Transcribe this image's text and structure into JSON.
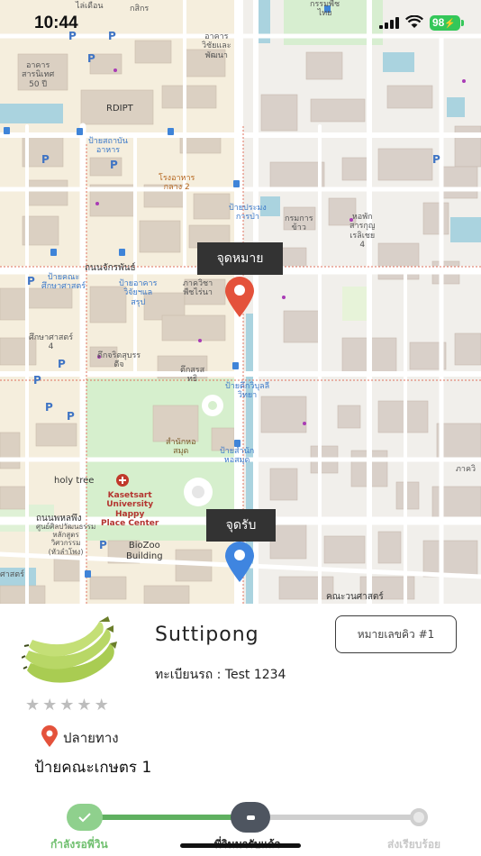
{
  "status_bar": {
    "time": "10:44",
    "battery": "98"
  },
  "map": {
    "labels": {
      "building_top": "ไล่เดือน",
      "building_top2": "กสิกร",
      "building_arts": "อาคาร\nวิชัยและ\nพัฒนา",
      "building_50y": "อาคาร\nสารนิเทศ\n50 ปี",
      "rdipt": "RDIPT",
      "canteen": "ป้ายสถาบัน\nอาหาร",
      "central2": "โรงอาหาร\nกลาง 2",
      "bus_stop_fisheries": "ป้ายประมง\nการป่า",
      "agri_dept": "กรมการ\nข้าว",
      "library_hall": "หอพัก\nสารกุญ\nเรลิเชย\n4",
      "chakphan_rd": "ถนนจักรพันธ์",
      "bus_stop_soc": "ป้ายคณะ\nศึกษาศาสตร์",
      "bus_stop_sci": "ป้ายอาคาร\nวิจัยฯแล\nสรุป",
      "museum": "ภาควิชา\nพืชไร่นา",
      "edu4": "ศึกษาศาสตร์\n4",
      "ktower": "ตึกจริตสุบรร\nดีจ",
      "tuk": "ตึกสรส\nทธิ",
      "bus_stop_vet": "ป้ายตึกวิบุลลี\nวิทยา",
      "library": "สำนักหอ\nสมุด",
      "bus_stop_lib": "ป้ายสำนัก\nหอสมุด",
      "holy_tree": "holy tree",
      "happy_place": "Kasetsart\nUniversity\nHappy\nPlace Center",
      "phahon_rd": "ถนนพหลพึง",
      "biozoo": "BioZoo\nBuilding",
      "science": "ศูนย์ศิลปวัฒนธรรม\nหลักสูตร\nวิศวกรรม\n(หัวลำโพง)",
      "agri_econ": "คณะวนศาสตร์",
      "econ_left": "ศาสตร์",
      "quiet": "กรรมพืช\nไทย",
      "law": "ภาควิ"
    },
    "pin_destination": "จุดหมาย",
    "pin_pickup": "จุดรับ"
  },
  "driver": {
    "name": "Suttipong",
    "plate_label": "ทะเบียนรถ : ",
    "plate_value": "Test 1234",
    "queue_button": "หมายเลขคิว #1",
    "rating_stars": 0,
    "rating_max": 5
  },
  "destination": {
    "label": "ปลายทาง",
    "place": "ป้ายคณะเกษตร 1"
  },
  "progress": {
    "steps": [
      {
        "label": "กำลังรอพี่วิน"
      },
      {
        "label": "พี่วินมารับแล้ว"
      },
      {
        "label": "ส่งเรียบร้อย"
      }
    ],
    "current_step": 2,
    "fill_fraction": 0.5
  },
  "colors": {
    "accent_green": "#5fb060",
    "pin_red": "#e4523b",
    "pin_blue": "#3f85e0",
    "callout_bg": "#333333"
  }
}
